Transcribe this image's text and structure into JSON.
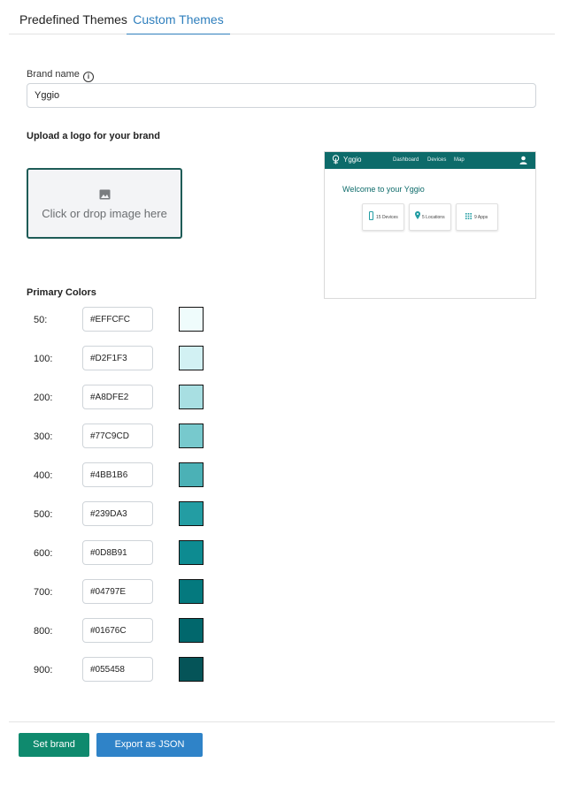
{
  "tabs": [
    {
      "label": "Predefined Themes",
      "active": false
    },
    {
      "label": "Custom Themes",
      "active": true
    }
  ],
  "brand": {
    "label": "Brand name",
    "value": "Yggio"
  },
  "logo": {
    "title": "Upload a logo for your brand",
    "dropzone_text": "Click or drop image here"
  },
  "preview": {
    "logo_text": "Yggio",
    "nav": [
      "Dashboard",
      "Devices",
      "Map"
    ],
    "welcome": "Welcome to your Yggio",
    "cards": [
      "15 Devices",
      "5 Locations",
      "9 Apps"
    ],
    "bar_color": "#0d6b6a"
  },
  "primary": {
    "title": "Primary Colors",
    "shades": [
      {
        "label": "50:",
        "hex": "#EFFCFC"
      },
      {
        "label": "100:",
        "hex": "#D2F1F3"
      },
      {
        "label": "200:",
        "hex": "#A8DFE2"
      },
      {
        "label": "300:",
        "hex": "#77C9CD"
      },
      {
        "label": "400:",
        "hex": "#4BB1B6"
      },
      {
        "label": "500:",
        "hex": "#239DA3"
      },
      {
        "label": "600:",
        "hex": "#0D8B91"
      },
      {
        "label": "700:",
        "hex": "#04797E"
      },
      {
        "label": "800:",
        "hex": "#01676C"
      },
      {
        "label": "900:",
        "hex": "#055458"
      }
    ]
  },
  "actions": {
    "set_brand": "Set brand",
    "export_json": "Export as JSON"
  }
}
